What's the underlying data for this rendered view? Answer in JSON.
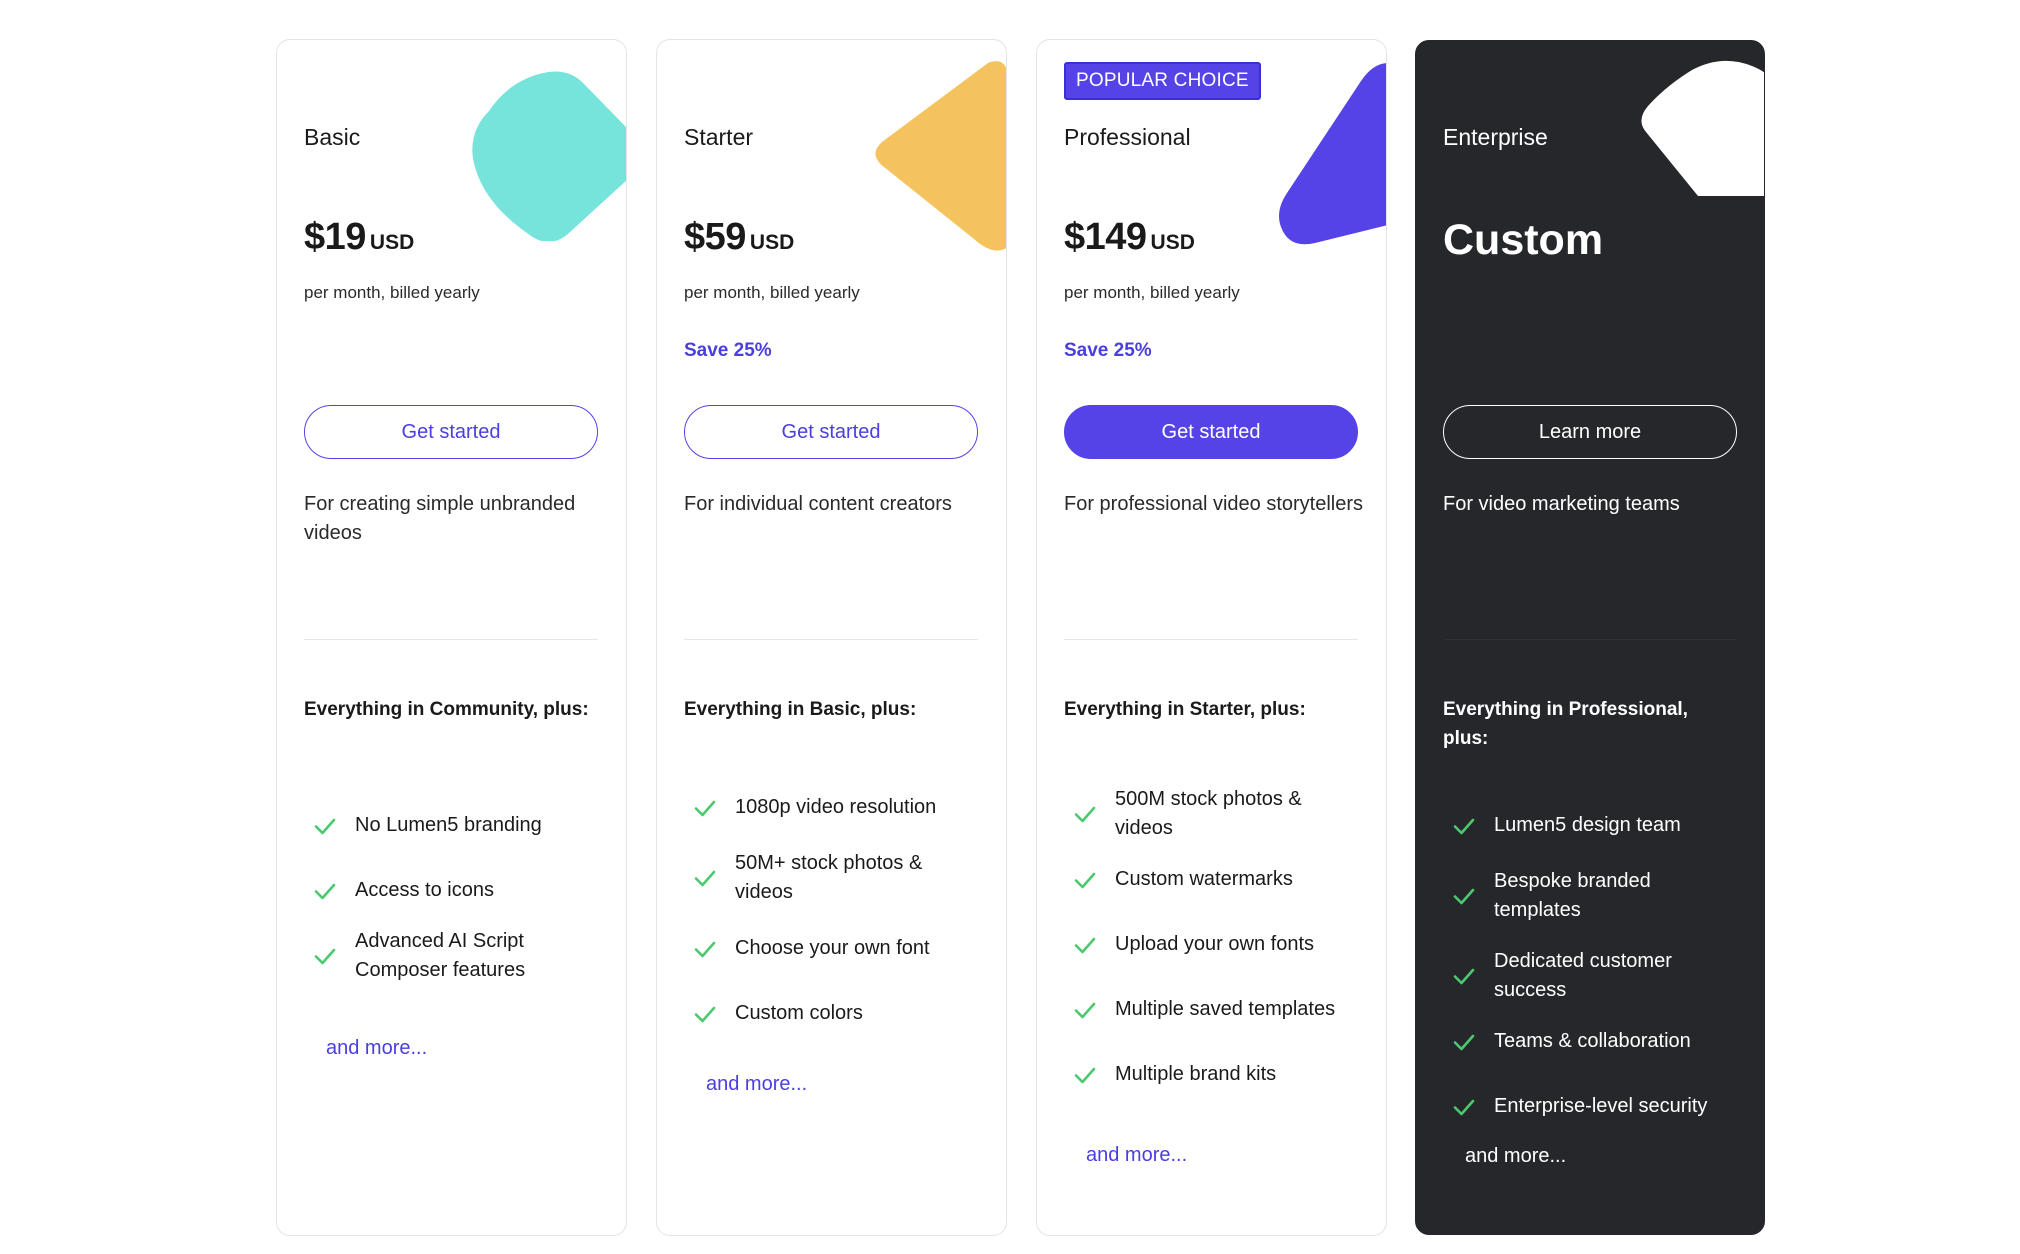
{
  "plans": [
    {
      "name": "Basic",
      "price": "$19",
      "currency": "USD",
      "billing": "per month, billed yearly",
      "save": "",
      "cta": "Get started",
      "description": "For creating simple unbranded videos",
      "features_heading": "Everything in Community, plus:",
      "features": [
        "No Lumen5 branding",
        "Access to icons",
        "Advanced AI Script Composer features"
      ],
      "more": "and more...",
      "shape_color": "#77e4dc"
    },
    {
      "name": "Starter",
      "price": "$59",
      "currency": "USD",
      "billing": "per month, billed yearly",
      "save": "Save 25%",
      "cta": "Get started",
      "description": "For individual content creators",
      "features_heading": "Everything in Basic, plus:",
      "features": [
        "1080p video resolution",
        "50M+ stock photos & videos",
        "Choose your own font",
        "Custom colors"
      ],
      "more": "and more...",
      "shape_color": "#f5c35e"
    },
    {
      "badge": "POPULAR CHOICE",
      "name": "Professional",
      "price": "$149",
      "currency": "USD",
      "billing": "per month, billed yearly",
      "save": "Save 25%",
      "cta": "Get started",
      "description": "For professional video storytellers",
      "features_heading": "Everything in Starter, plus:",
      "features": [
        "500M stock photos & videos",
        "Custom watermarks",
        "Upload your own fonts",
        "Multiple saved templates",
        "Multiple brand kits"
      ],
      "more": "and more...",
      "shape_color": "#5643e8"
    },
    {
      "name": "Enterprise",
      "price": "Custom",
      "cta": "Learn more",
      "description": "For video marketing teams",
      "features_heading": "Everything in Professional, plus:",
      "features": [
        "Lumen5 design team",
        "Bespoke branded templates",
        "Dedicated customer success",
        "Teams & collaboration",
        "Enterprise-level security"
      ],
      "more": "and more...",
      "shape_color": "#ffffff"
    }
  ],
  "colors": {
    "accent": "#5643e8",
    "check": "#4cc96f",
    "dark_card": "#25272b"
  }
}
